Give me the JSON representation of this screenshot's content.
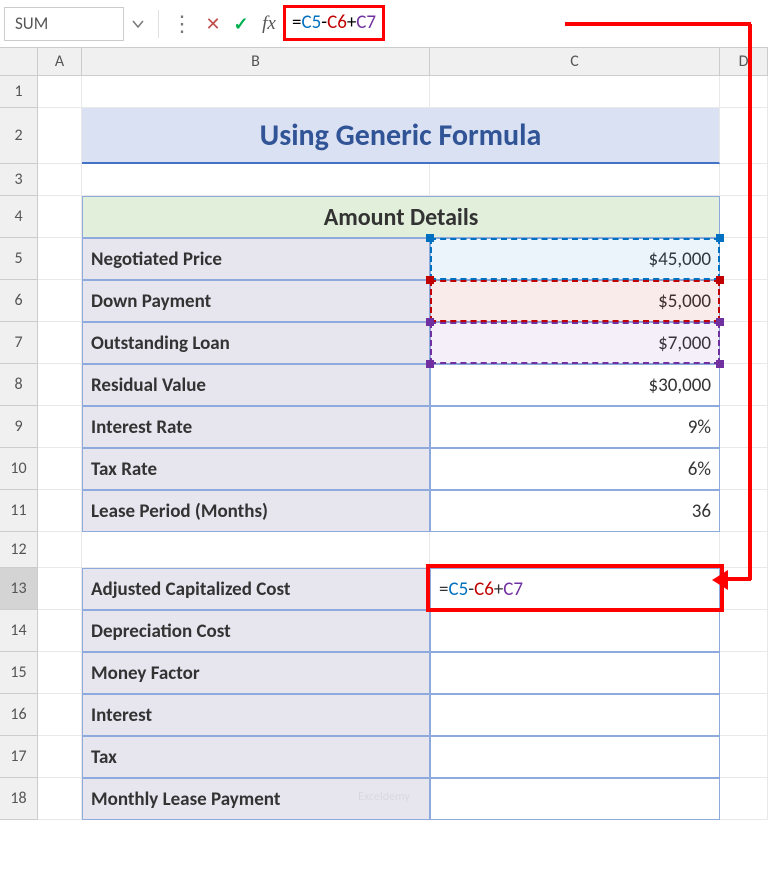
{
  "formulaBar": {
    "nameBox": "SUM",
    "formula": "=C5-C6+C7",
    "ref1": "C5",
    "ref2": "C6",
    "ref3": "C7"
  },
  "columns": {
    "A": "A",
    "B": "B",
    "C": "C",
    "D": "D"
  },
  "rows": [
    "1",
    "2",
    "3",
    "4",
    "5",
    "6",
    "7",
    "8",
    "9",
    "10",
    "11",
    "12",
    "13",
    "14",
    "15",
    "16",
    "17",
    "18"
  ],
  "title": "Using Generic Formula",
  "sectionHeader": "Amount Details",
  "details": [
    {
      "label": "Negotiated Price",
      "value": "$45,000"
    },
    {
      "label": "Down Payment",
      "value": "$5,000"
    },
    {
      "label": "Outstanding Loan",
      "value": "$7,000"
    },
    {
      "label": "Residual Value",
      "value": "$30,000"
    },
    {
      "label": "Interest Rate",
      "value": "9%"
    },
    {
      "label": "Tax Rate",
      "value": "6%"
    },
    {
      "label": "Lease Period (Months)",
      "value": "36"
    }
  ],
  "calc": [
    {
      "label": "Adjusted Capitalized Cost",
      "value": "=C5-C6+C7"
    },
    {
      "label": "Depreciation Cost",
      "value": ""
    },
    {
      "label": "Money Factor",
      "value": ""
    },
    {
      "label": "Interest",
      "value": ""
    },
    {
      "label": "Tax",
      "value": ""
    },
    {
      "label": "Monthly Lease Payment",
      "value": ""
    }
  ],
  "watermark": "Exceldemy"
}
